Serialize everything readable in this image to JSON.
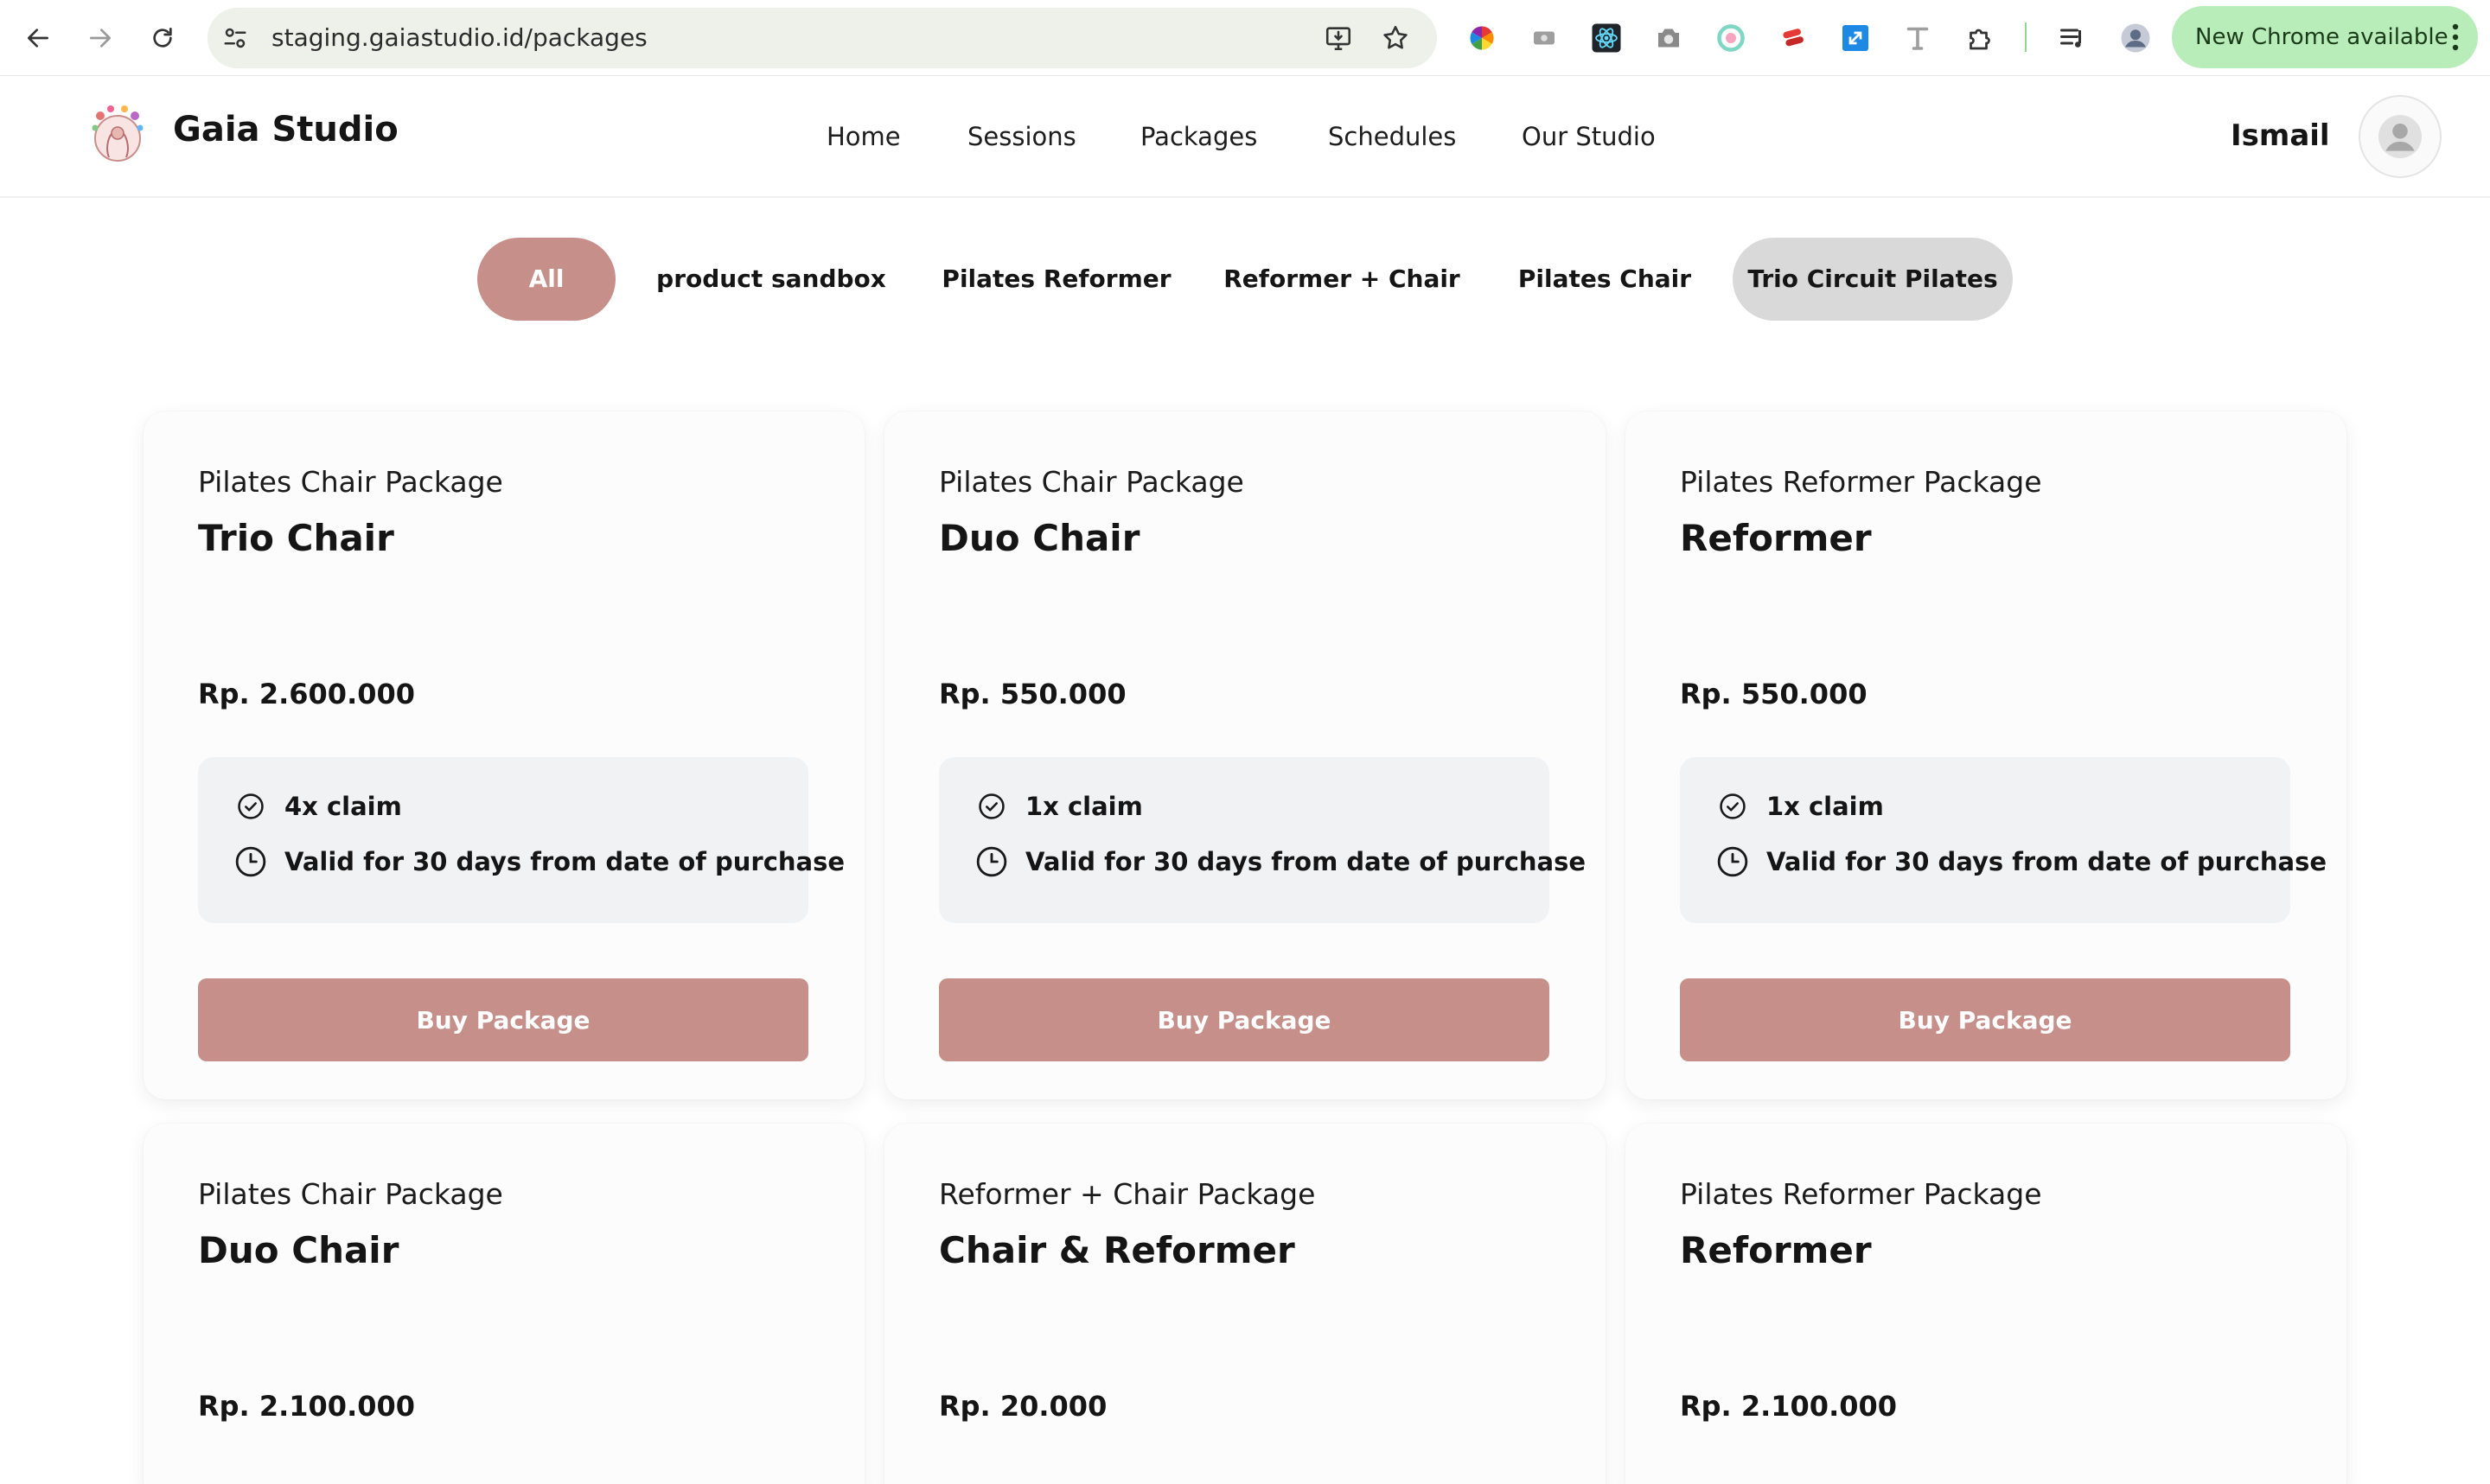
{
  "browser": {
    "url": "staging.gaiastudio.id/packages",
    "update_label": "New Chrome available",
    "extensions": [
      "color-wheel-icon",
      "rectangle-extension-icon",
      "react-devtools-icon",
      "camera-icon",
      "circle-extension-icon",
      "stack-extension-icon",
      "resize-icon",
      "font-t-icon",
      "puzzle-icon"
    ]
  },
  "header": {
    "brand": "Gaia Studio",
    "nav": [
      {
        "label": "Home"
      },
      {
        "label": "Sessions"
      },
      {
        "label": "Packages"
      },
      {
        "label": "Schedules"
      },
      {
        "label": "Our Studio"
      }
    ],
    "user_name": "Ismail"
  },
  "filters": [
    {
      "label": "All",
      "state": "active"
    },
    {
      "label": "product sandbox",
      "state": "normal"
    },
    {
      "label": "Pilates Reformer",
      "state": "normal"
    },
    {
      "label": "Reformer + Chair",
      "state": "normal"
    },
    {
      "label": "Pilates Chair",
      "state": "normal"
    },
    {
      "label": "Trio Circuit Pilates",
      "state": "hovered"
    }
  ],
  "packages": [
    {
      "category": "Pilates Chair Package",
      "title": "Trio Chair",
      "price": "Rp. 2.600.000",
      "claim": "4x claim",
      "validity": "Valid for 30 days from date of purchase",
      "button": "Buy Package"
    },
    {
      "category": "Pilates Chair Package",
      "title": "Duo Chair",
      "price": "Rp. 550.000",
      "claim": "1x claim",
      "validity": "Valid for 30 days from date of purchase",
      "button": "Buy Package"
    },
    {
      "category": "Pilates Reformer Package",
      "title": "Reformer",
      "price": "Rp. 550.000",
      "claim": "1x claim",
      "validity": "Valid for 30 days from date of purchase",
      "button": "Buy Package"
    },
    {
      "category": "Pilates Chair Package",
      "title": "Duo Chair",
      "price": "Rp. 2.100.000"
    },
    {
      "category": "Reformer + Chair Package",
      "title": "Chair & Reformer",
      "price": "Rp. 20.000"
    },
    {
      "category": "Pilates Reformer Package",
      "title": "Reformer",
      "price": "Rp. 2.100.000"
    }
  ],
  "colors": {
    "accent": "#c68f8a",
    "tab_hover": "#d9d9d9",
    "feature_bg": "#f1f2f4",
    "update_pill": "#b8ecb8"
  }
}
